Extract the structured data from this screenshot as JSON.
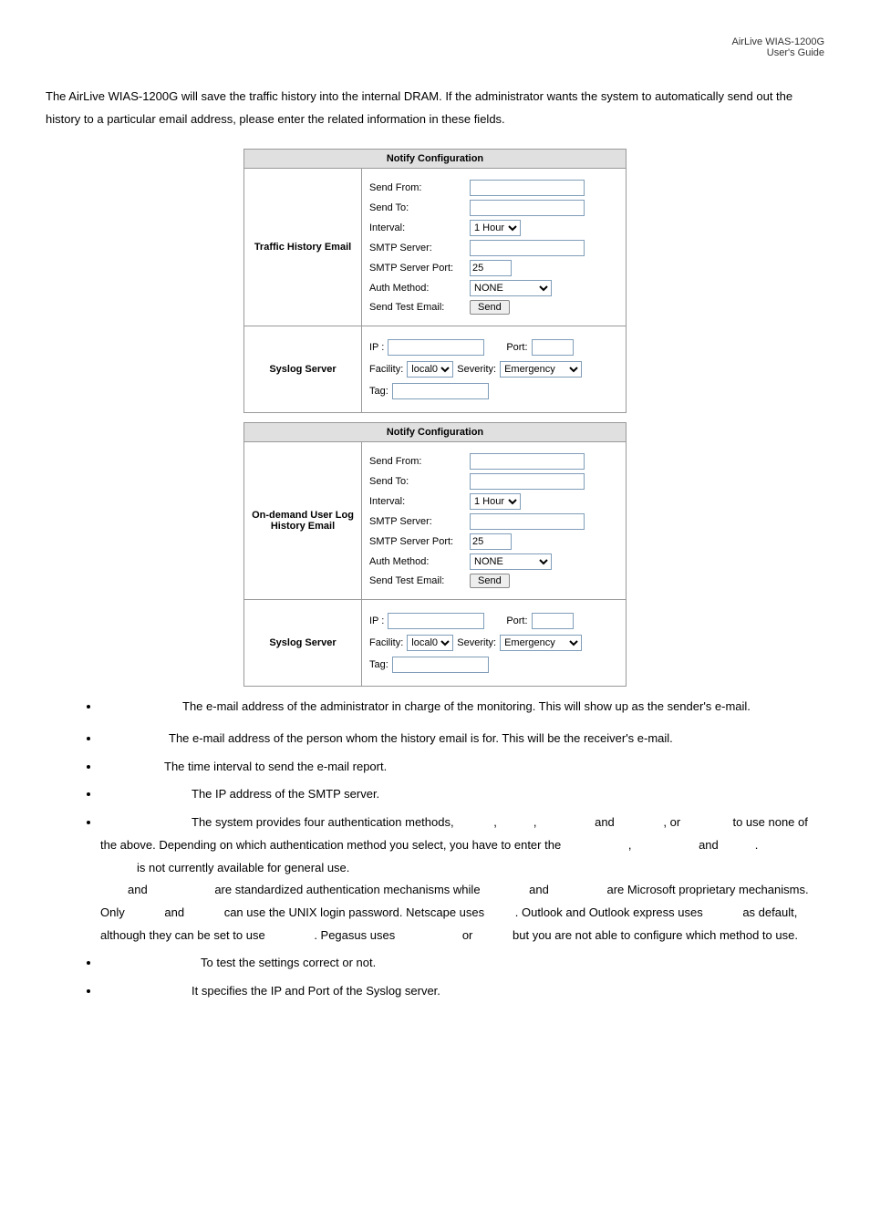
{
  "header": {
    "product": "AirLive WIAS-1200G",
    "doc": "User's Guide"
  },
  "intro": "The AirLive WIAS-1200G will save the traffic history into the internal DRAM. If the administrator wants the system to automatically send out the history to a particular email address, please enter the related information in these fields.",
  "table": {
    "section_header": "Notify Configuration",
    "row1_label": "Traffic History Email",
    "row2_label": "Syslog Server",
    "row3_label": "On-demand User Log History Email",
    "row4_label": "Syslog Server",
    "labels": {
      "send_from": "Send From:",
      "send_to": "Send To:",
      "interval": "Interval:",
      "smtp_server": "SMTP Server:",
      "smtp_port": "SMTP Server Port:",
      "auth_method": "Auth Method:",
      "send_test": "Send Test Email:",
      "ip": "IP :",
      "port": "Port:",
      "facility": "Facility:",
      "severity": "Severity:",
      "tag": "Tag:"
    },
    "values": {
      "interval": "1 Hour",
      "port25": "25",
      "auth_none": "NONE",
      "send_btn": "Send",
      "facility_val": "local0",
      "severity_val": "Emergency"
    }
  },
  "bullets": {
    "b1": "The e-mail address of the administrator in charge of the monitoring. This will show up as the sender's e-mail.",
    "b2": "The e-mail address of the person whom the history email is for. This will be the receiver's e-mail.",
    "b3": "The time interval to send the e-mail report.",
    "b4": "The IP address of the SMTP server.",
    "b5_a": "The system provides four authentication methods,",
    "b5_b": "and",
    "b5_c": ", or",
    "b5_d": "to use none of the above. Depending on which authentication method you select, you have to enter the",
    "b5_e": "and",
    "b5_f": "is not currently available for general use.",
    "b5_g1": "and",
    "b5_g2": "are standardized authentication mechanisms while",
    "b5_g3": "and",
    "b5_g4": "are Microsoft proprietary mechanisms. Only",
    "b5_g5": "and",
    "b5_g6": "can use the UNIX login password. Netscape uses",
    "b5_g7": ". Outlook and Outlook express uses",
    "b5_g8": "as default, although they can be set to use",
    "b5_g9": ". Pegasus uses",
    "b5_g10": "or",
    "b5_g11": "but you are not able to configure which method to use.",
    "b6": "To test the settings correct or not.",
    "b7": "It specifies the IP and Port of the Syslog server."
  }
}
